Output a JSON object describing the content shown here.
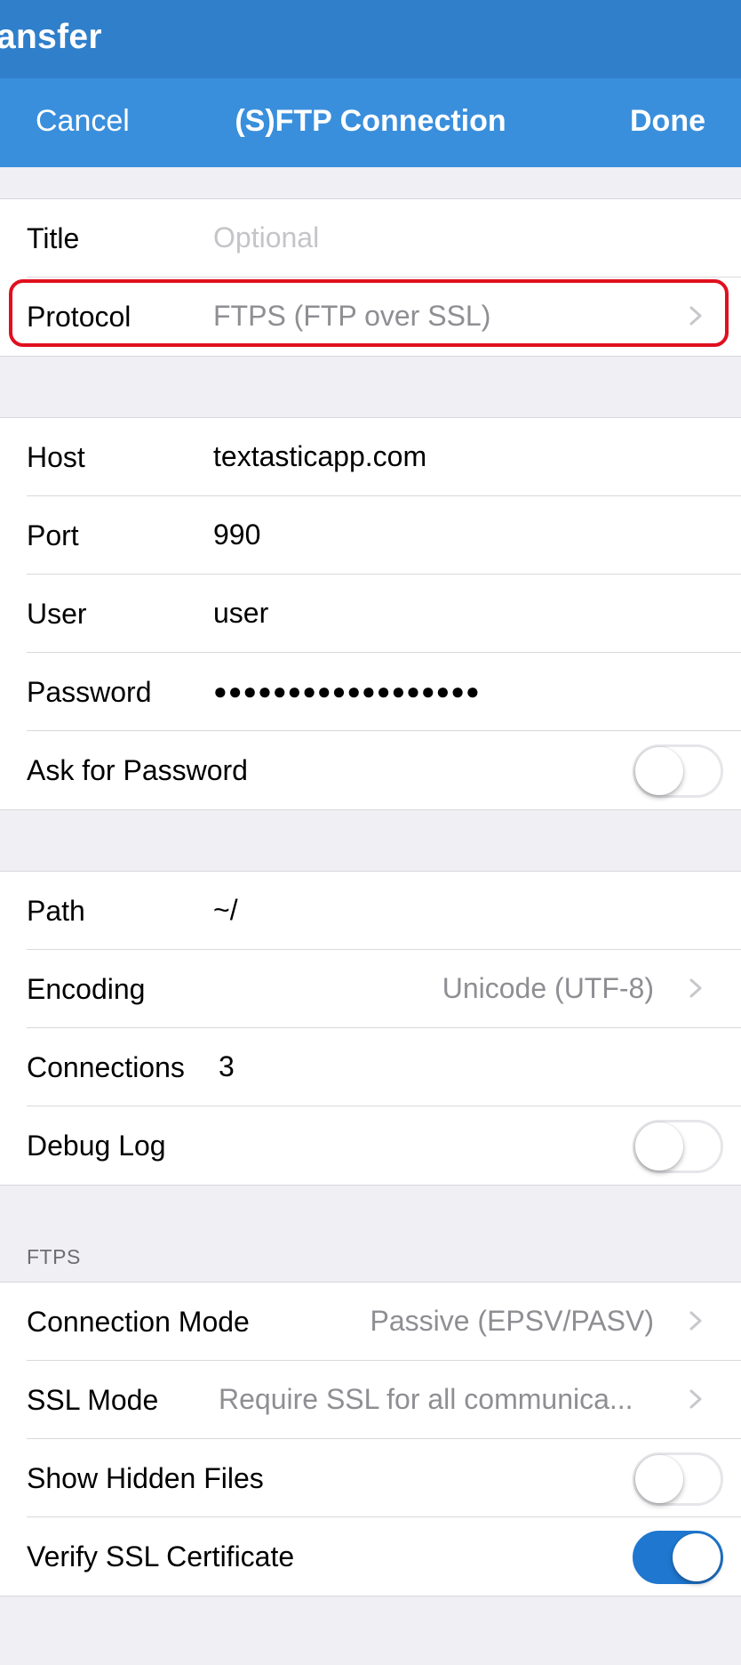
{
  "app": {
    "strip_title": "ansfer"
  },
  "navbar": {
    "cancel_label": "Cancel",
    "title": "(S)FTP Connection",
    "done_label": "Done"
  },
  "general": {
    "title_label": "Title",
    "title_placeholder": "Optional",
    "protocol_label": "Protocol",
    "protocol_value": "FTPS (FTP over SSL)"
  },
  "server": {
    "host_label": "Host",
    "host_value": "textasticapp.com",
    "port_label": "Port",
    "port_value": "990",
    "user_label": "User",
    "user_value": "user",
    "password_label": "Password",
    "password_value": "●●●●●●●●●●●●●●●●●●",
    "ask_password_label": "Ask for Password",
    "ask_password_on": false
  },
  "options": {
    "path_label": "Path",
    "path_value": "~/",
    "encoding_label": "Encoding",
    "encoding_value": "Unicode (UTF-8)",
    "connections_label": "Connections",
    "connections_value": "3",
    "debug_log_label": "Debug Log",
    "debug_log_on": false
  },
  "ftps": {
    "header": "FTPS",
    "connection_mode_label": "Connection Mode",
    "connection_mode_value": "Passive (EPSV/PASV)",
    "ssl_mode_label": "SSL Mode",
    "ssl_mode_value": "Require SSL for all communica...",
    "show_hidden_label": "Show Hidden Files",
    "show_hidden_on": false,
    "verify_ssl_label": "Verify SSL Certificate",
    "verify_ssl_on": true
  },
  "colors": {
    "accent": "#3a8fdc",
    "toggle_on": "#1f77cf",
    "highlight": "#e0101e"
  },
  "icons": {
    "disclosure": "chevron-right-icon"
  }
}
